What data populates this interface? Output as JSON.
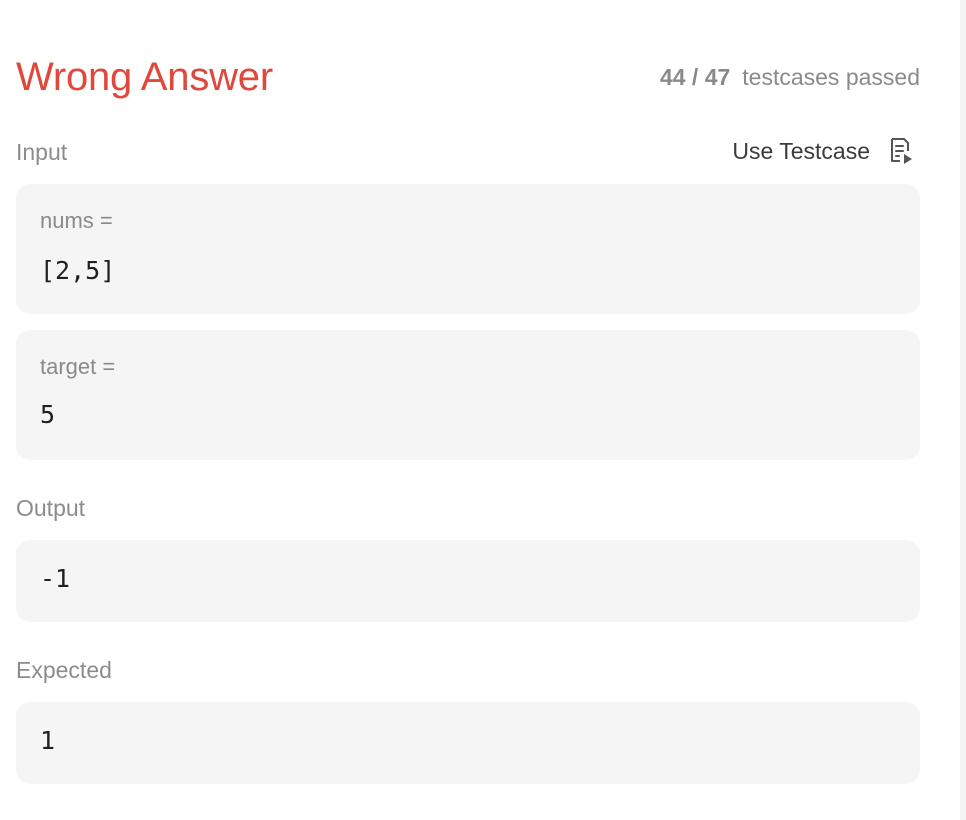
{
  "result": {
    "status": "Wrong Answer",
    "passed": "44 / 47",
    "passed_suffix": "testcases passed",
    "status_color": "#e0483c"
  },
  "input": {
    "label": "Input",
    "use_testcase_label": "Use Testcase",
    "use_testcase_icon": "document-play-icon",
    "params": [
      {
        "name": "nums =",
        "value": "[2,5]"
      },
      {
        "name": "target =",
        "value": "5"
      }
    ]
  },
  "output": {
    "label": "Output",
    "value": "-1"
  },
  "expected": {
    "label": "Expected",
    "value": "1"
  }
}
